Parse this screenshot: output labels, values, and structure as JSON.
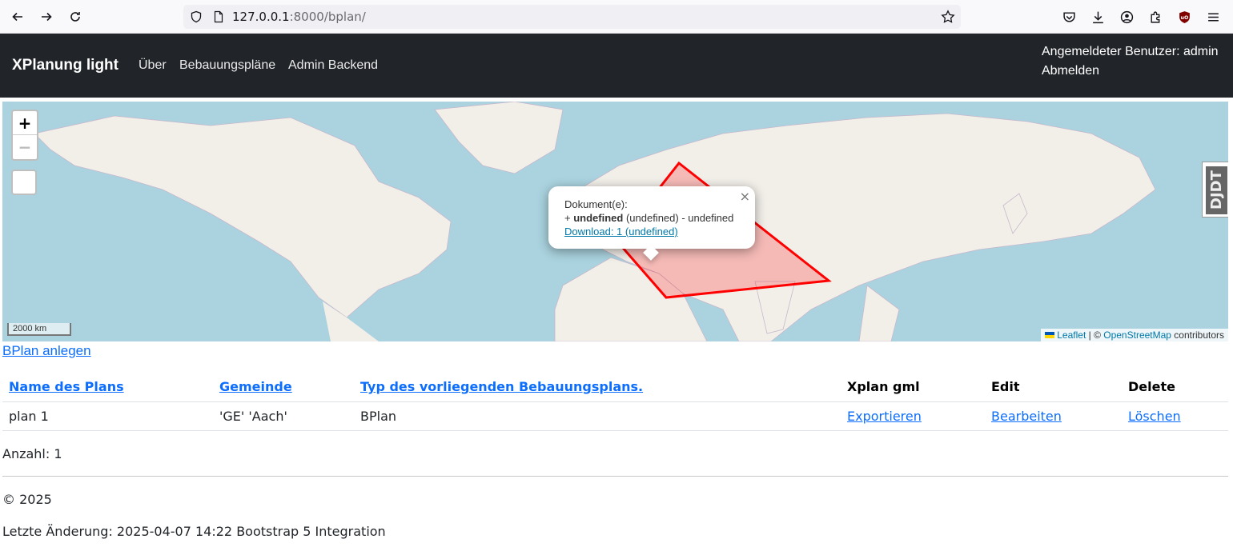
{
  "browser": {
    "url_host": "127.0.0.1",
    "url_rest": ":8000/bplan/"
  },
  "navbar": {
    "brand": "XPlanung light",
    "links": [
      "Über",
      "Bebauungspläne",
      "Admin Backend"
    ],
    "user_label": "Angemeldeter Benutzer: admin",
    "logout": "Abmelden"
  },
  "map": {
    "zoom_in": "+",
    "zoom_out": "−",
    "scale": "2000 km",
    "attribution": {
      "leaflet": "Leaflet",
      "separator": " | © ",
      "osm": "OpenStreetMap",
      "suffix": " contributors"
    },
    "side_tab": "DJDT",
    "popup": {
      "close": "×",
      "line1": "Dokument(e):",
      "line2_prefix": "+ ",
      "line2_bold": "undefined",
      "line2_suffix": " (undefined) - undefined",
      "link": "Download: 1 (undefined)"
    },
    "polygon_color": "#ff0000"
  },
  "create_link": "BPlan anlegen",
  "table": {
    "headers": {
      "name": "Name des Plans",
      "gemeinde": "Gemeinde",
      "typ": "Typ des vorliegenden Bebauungsplans.",
      "xplan": "Xplan gml",
      "edit": "Edit",
      "delete": "Delete"
    },
    "rows": [
      {
        "name": "plan 1",
        "gemeinde": "'GE' 'Aach'",
        "typ": "BPlan",
        "export": "Exportieren",
        "edit": "Bearbeiten",
        "delete": "Löschen"
      }
    ]
  },
  "count": "Anzahl: 1",
  "footer": {
    "copyright": "© 2025",
    "last_change": "Letzte Änderung: 2025-04-07 14:22 Bootstrap 5 Integration"
  },
  "colors": {
    "navbar_bg": "#212529",
    "link": "#0d6efd",
    "water": "#aad3df",
    "land": "#f2efe9"
  }
}
